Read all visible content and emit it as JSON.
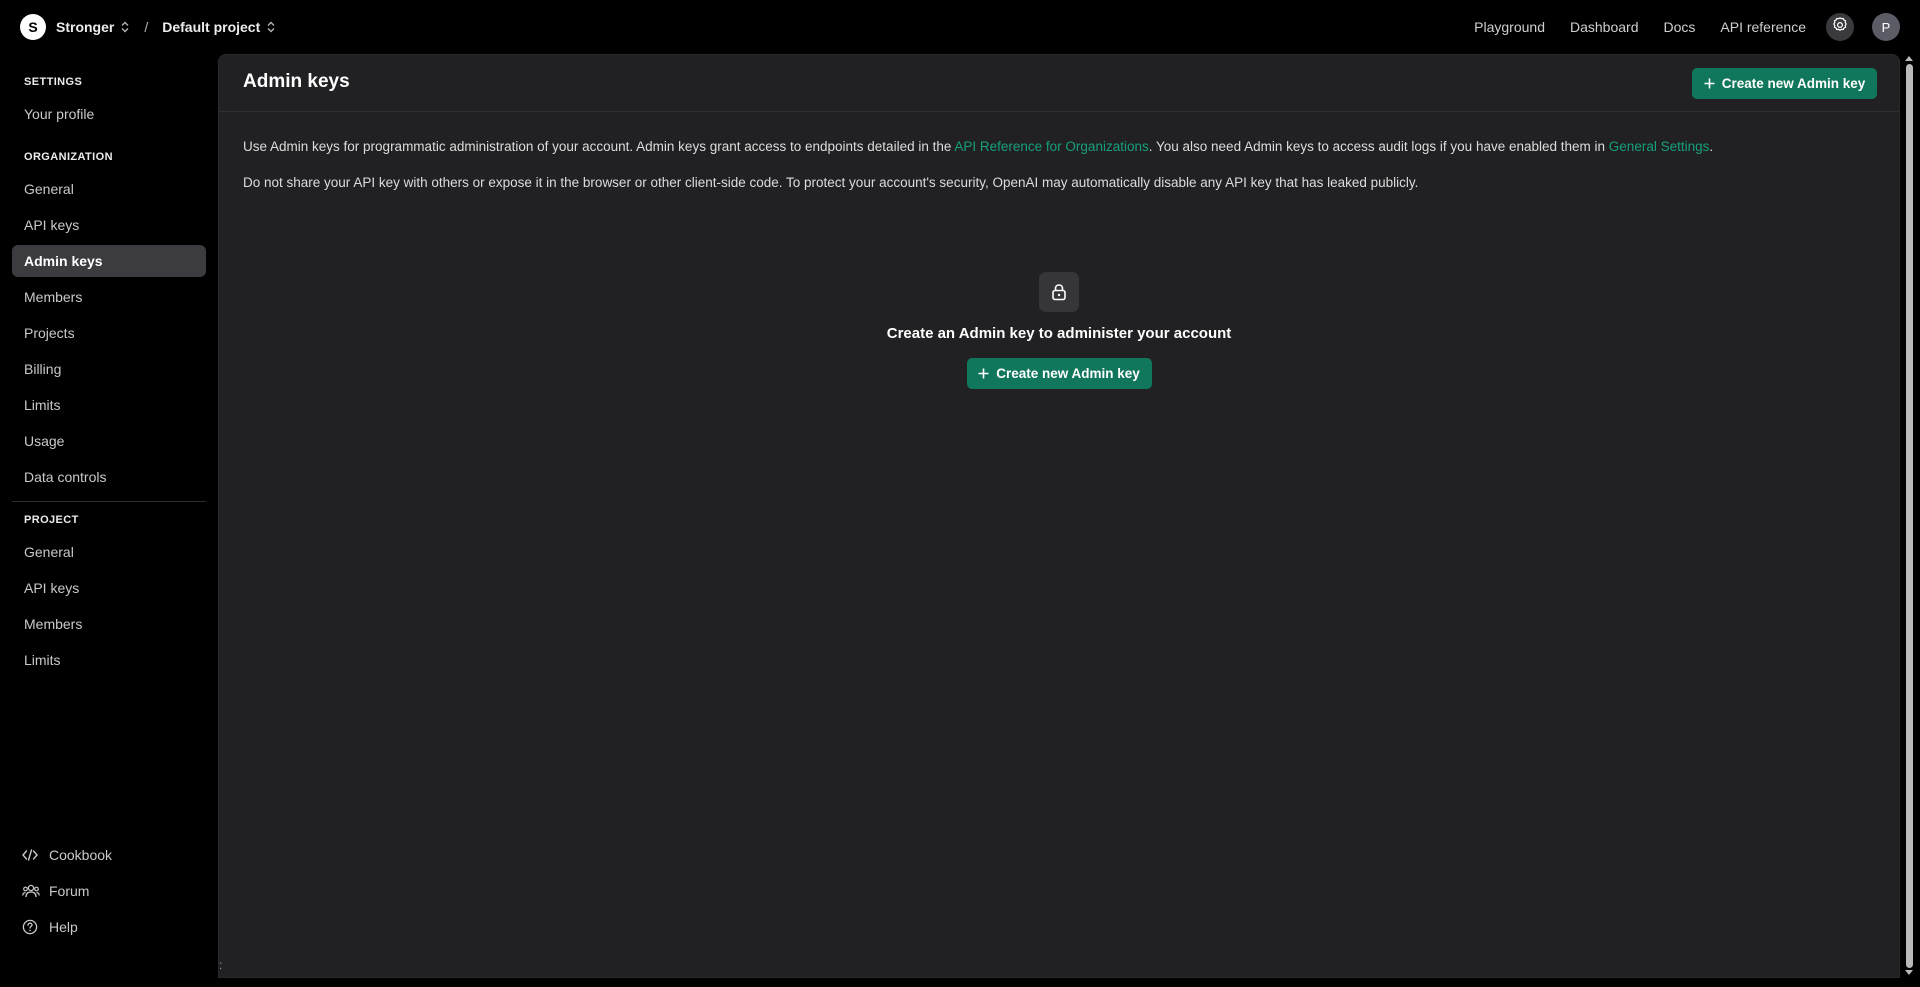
{
  "topbar": {
    "org_initial": "S",
    "org_name": "Stronger",
    "separator": "/",
    "project_name": "Default project",
    "nav": [
      "Playground",
      "Dashboard",
      "Docs",
      "API reference"
    ],
    "user_initial": "P"
  },
  "sidebar": {
    "settings_title": "SETTINGS",
    "settings_items": [
      "Your profile"
    ],
    "organization_title": "ORGANIZATION",
    "organization_items": [
      "General",
      "API keys",
      "Admin keys",
      "Members",
      "Projects",
      "Billing",
      "Limits",
      "Usage",
      "Data controls"
    ],
    "active_item": "Admin keys",
    "project_title": "PROJECT",
    "project_items": [
      "General",
      "API keys",
      "Members",
      "Limits"
    ],
    "footer": [
      {
        "label": "Cookbook",
        "icon": "code-icon"
      },
      {
        "label": "Forum",
        "icon": "people-icon"
      },
      {
        "label": "Help",
        "icon": "help-icon"
      }
    ]
  },
  "main": {
    "title": "Admin keys",
    "create_button": "Create new Admin key",
    "desc1": {
      "before": "Use Admin keys for programmatic administration of your account. Admin keys grant access to endpoints detailed in the ",
      "link1": "API Reference for Organizations",
      "middle": ". You also need Admin keys to access audit logs if you have enabled them in ",
      "link2": "General Settings",
      "after": "."
    },
    "desc2": "Do not share your API key with others or expose it in the browser or other client-side code. To protect your account's security, OpenAI may automatically disable any API key that has leaked publicly.",
    "empty": {
      "icon": "lock-icon",
      "title": "Create an Admin key to administer your account",
      "button": "Create new Admin key"
    }
  },
  "colors": {
    "accent": "#10775c",
    "link": "#16a07a",
    "panel": "#212124",
    "background": "#000000"
  }
}
